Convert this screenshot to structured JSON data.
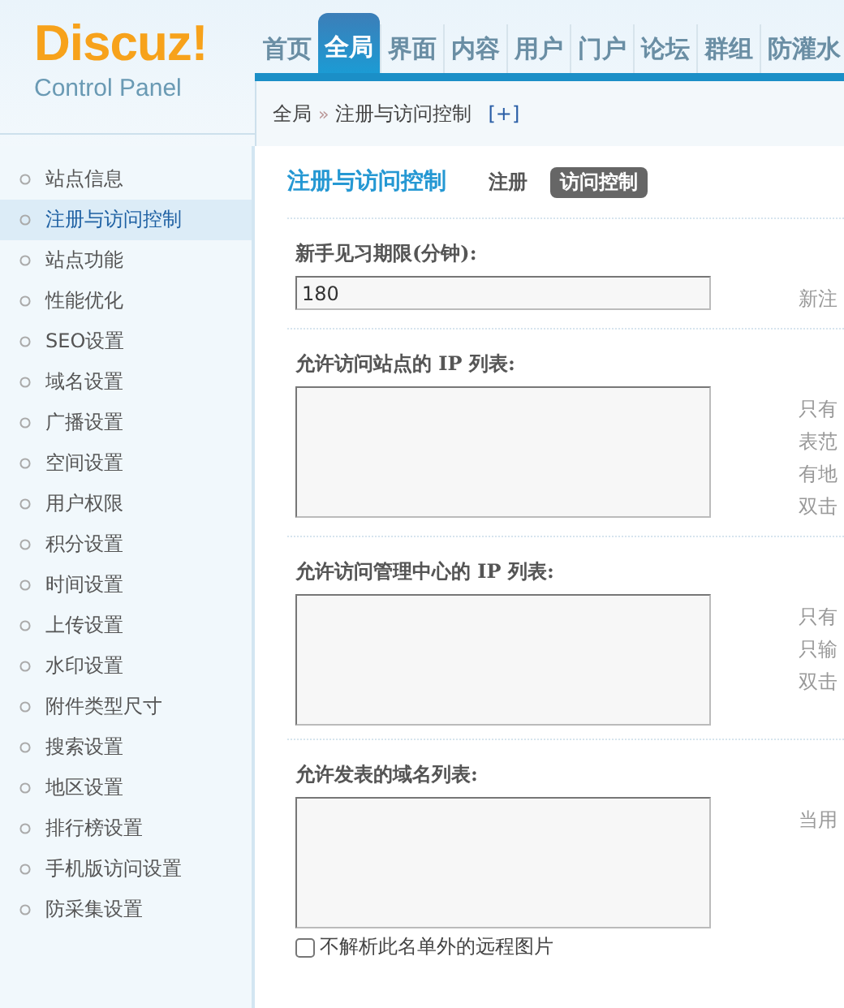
{
  "logo": {
    "name": "Discuz!",
    "subtitle": "Control Panel"
  },
  "nav_tabs": [
    {
      "label": "首页",
      "selected": false
    },
    {
      "label": "全局",
      "selected": true
    },
    {
      "label": "界面",
      "selected": false
    },
    {
      "label": "内容",
      "selected": false
    },
    {
      "label": "用户",
      "selected": false
    },
    {
      "label": "门户",
      "selected": false
    },
    {
      "label": "论坛",
      "selected": false
    },
    {
      "label": "群组",
      "selected": false
    },
    {
      "label": "防灌水",
      "selected": false
    }
  ],
  "breadcrumb": {
    "items": [
      "全局",
      "注册与访问控制"
    ],
    "separator": "»",
    "toggle": "[+]"
  },
  "sidebar": {
    "items": [
      {
        "label": "站点信息",
        "selected": false
      },
      {
        "label": "注册与访问控制",
        "selected": true
      },
      {
        "label": "站点功能",
        "selected": false
      },
      {
        "label": "性能优化",
        "selected": false
      },
      {
        "label": "SEO设置",
        "selected": false
      },
      {
        "label": "域名设置",
        "selected": false
      },
      {
        "label": "广播设置",
        "selected": false
      },
      {
        "label": "空间设置",
        "selected": false
      },
      {
        "label": "用户权限",
        "selected": false
      },
      {
        "label": "积分设置",
        "selected": false
      },
      {
        "label": "时间设置",
        "selected": false
      },
      {
        "label": "上传设置",
        "selected": false
      },
      {
        "label": "水印设置",
        "selected": false
      },
      {
        "label": "附件类型尺寸",
        "selected": false
      },
      {
        "label": "搜索设置",
        "selected": false
      },
      {
        "label": "地区设置",
        "selected": false
      },
      {
        "label": "排行榜设置",
        "selected": false
      },
      {
        "label": "手机版访问设置",
        "selected": false
      },
      {
        "label": "防采集设置",
        "selected": false
      }
    ]
  },
  "page": {
    "title": "注册与访问控制",
    "subtabs": [
      {
        "label": "注册",
        "selected": false
      },
      {
        "label": "访问控制",
        "selected": true
      }
    ]
  },
  "settings": [
    {
      "kind": "text",
      "label": "新手见习期限(分钟):",
      "value": "180",
      "hint": [
        "新注"
      ]
    },
    {
      "kind": "textarea",
      "label": "允许访问站点的 IP 列表:",
      "hint": [
        "只有",
        "表范",
        "有地",
        "双击"
      ]
    },
    {
      "kind": "textarea",
      "label": "允许访问管理中心的 IP 列表:",
      "hint": [
        "只有",
        "只输",
        "双击"
      ]
    },
    {
      "kind": "textarea",
      "label": "允许发表的域名列表:",
      "hint": [
        "当用"
      ],
      "option": {
        "label": "不解析此名单外的远程图片",
        "checked": false
      }
    }
  ]
}
